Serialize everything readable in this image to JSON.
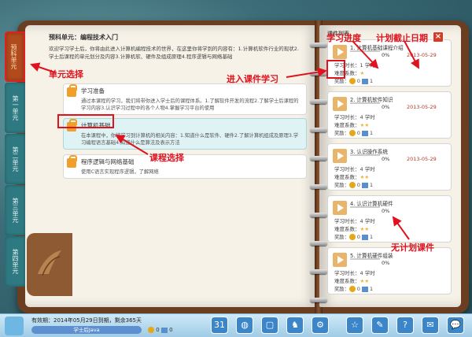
{
  "unit_tabs": [
    "预科单元",
    "第一单元",
    "第二单元",
    "第三单元",
    "第四单元"
  ],
  "header": {
    "title": "预科单元：编程技术入门",
    "description": "欢迎学习学士后，你将由此进入计算机编程技术的世界，在这里你将学到的内容有：1.计算机软件行业的现状2.学士后课程的单元划分及内容3.计算机软、硬件及组成原理4.程序逻辑与网络基础"
  },
  "courses": [
    {
      "title": "学习准备",
      "desc": "通过本课程的学习，我们将带你进入学士后的课程体系。1.了解软件开发的流程2.了解学士后课程的学习内容3.认识学习过程中的各个人物4.掌握学习平台的使用"
    },
    {
      "title": "计算机基础",
      "desc": "在本课程中，你将学习到计算机的相关内容：1.知道什么是软件、硬件2.了解计算机组成及原理3.学习编程语言基础4.知道什么是算法及表示方法"
    },
    {
      "title": "程序逻辑与网络基础",
      "desc": "使用C语言实现程序逻辑，了解网络"
    }
  ],
  "right": {
    "list_label": "课件列表",
    "close": "×",
    "wares": [
      {
        "title": "1. 计算机基础课程介绍",
        "pct": "0%",
        "date": "2013-05-29",
        "hours": "学习时长：1  学时",
        "difficulty": "难度系数：",
        "stars": "★",
        "reward": "奖励：",
        "coins": "0",
        "books": "1"
      },
      {
        "title": "2. 计算机软件知识",
        "pct": "0%",
        "date": "2013-05-29",
        "hours": "学习时长：4  学时",
        "difficulty": "难度系数：",
        "stars": "★★",
        "reward": "奖励：",
        "coins": "0",
        "books": "1"
      },
      {
        "title": "3. 认识操作系统",
        "pct": "0%",
        "date": "2013-05-29",
        "hours": "学习时长：4  学时",
        "difficulty": "难度系数：",
        "stars": "★★",
        "reward": "奖励：",
        "coins": "0",
        "books": "1"
      },
      {
        "title": "4. 认识计算机硬件",
        "pct": "0%",
        "date": "",
        "hours": "学习时长：4  学时",
        "difficulty": "难度系数：",
        "stars": "★★",
        "reward": "奖励：",
        "coins": "0",
        "books": "1"
      },
      {
        "title": "5. 计算机硬件组装",
        "pct": "0%",
        "date": "",
        "hours": "学习时长：4  学时",
        "difficulty": "难度系数：",
        "stars": "★★",
        "reward": "奖励：",
        "coins": "0",
        "books": "1"
      }
    ]
  },
  "annotations": {
    "unit_select": "单元选择",
    "enter": "进入课件学习",
    "course_select": "课程选择",
    "progress": "学习进度",
    "deadline": "计划截止日期",
    "no_plan": "无计划课件"
  },
  "bottom": {
    "valid": "有效期：2014年05月29日到期，剩余365天",
    "name": "学士后Java",
    "coins": "0",
    "books": "0",
    "buttons": [
      "31",
      "◍",
      "▢",
      "♞",
      "⚙",
      "☆",
      "✎",
      "?",
      "✉",
      "💬"
    ]
  },
  "colors": {
    "accent": "#e0121e",
    "tab": "#2f7a82",
    "active_tab": "#b14a1d"
  }
}
